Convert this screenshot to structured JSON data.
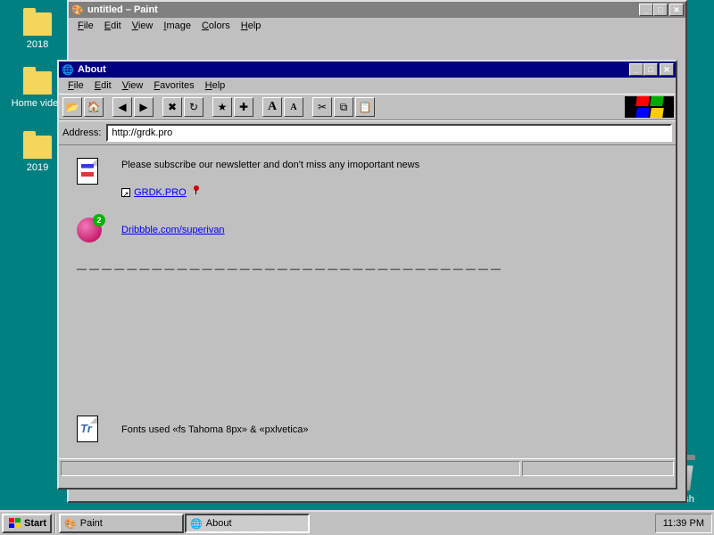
{
  "desktop": {
    "icons": [
      {
        "label": "2018"
      },
      {
        "label": "Home video"
      },
      {
        "label": "2019"
      }
    ],
    "trash_label": "Trash"
  },
  "paint_window": {
    "title": "untitled – Paint",
    "menu": [
      "File",
      "Edit",
      "View",
      "Image",
      "Colors",
      "Help"
    ]
  },
  "about_window": {
    "title": "About",
    "menu": [
      "File",
      "Edit",
      "View",
      "Favorites",
      "Help"
    ],
    "address_label": "Address:",
    "address_value": "http://grdk.pro",
    "newsletter_text": "Please subscribe our newsletter and don't miss any imoportant news",
    "link_grdk": "GRDK.PRO",
    "link_dribbble": "Dribbble.com/superivan",
    "dribbble_badge": "2",
    "divider": "— — — — — — — — — — — — — — — — — — — — — — — — — — — — — — — — — — ",
    "fonts_text": "Fonts used «fs Tahoma 8px» & «pxlvetica»"
  },
  "taskbar": {
    "start": "Start",
    "items": [
      {
        "label": "Paint",
        "active": false
      },
      {
        "label": "About",
        "active": true
      }
    ],
    "clock": "11:39 PM"
  },
  "toolbar_icons": {
    "open": "📂",
    "home": "🏠",
    "back": "◀",
    "fwd": "▶",
    "stop": "✖",
    "refresh": "↻",
    "fav1": "★",
    "fav2": "✚",
    "fontup": "A",
    "fontdn": "A",
    "cut": "✂",
    "copy": "⧉",
    "paste": "📋"
  }
}
